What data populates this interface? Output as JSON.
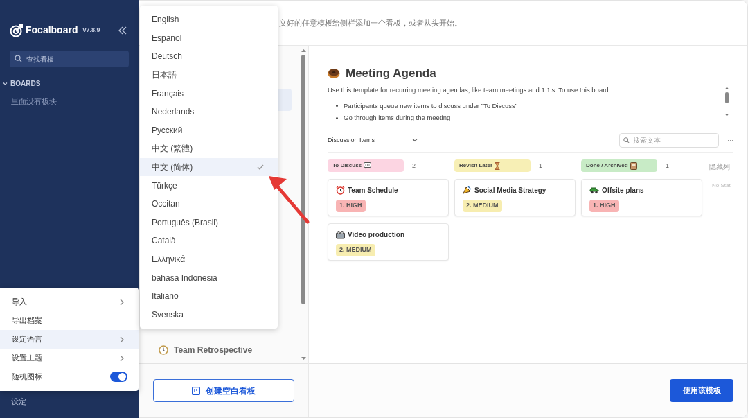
{
  "sidebar": {
    "logo": "Focalboard",
    "version": "v7.8.9",
    "search": {
      "placeholder": "查找看板"
    },
    "section": "BOARDS",
    "empty_text": "里面没有板块",
    "settings": "设定"
  },
  "settings_menu": [
    {
      "label": "导入",
      "kind": "submenu",
      "selected": false
    },
    {
      "label": "导出档案",
      "kind": "action",
      "selected": false
    },
    {
      "label": "设定语言",
      "kind": "submenu",
      "selected": true
    },
    {
      "label": "设置主题",
      "kind": "submenu",
      "selected": false
    },
    {
      "label": "随机图标",
      "kind": "toggle",
      "selected": false,
      "on": true
    }
  ],
  "language_menu": [
    {
      "label": "English",
      "selected": false
    },
    {
      "label": "Español",
      "selected": false
    },
    {
      "label": "Deutsch",
      "selected": false
    },
    {
      "label": "日本語",
      "selected": false
    },
    {
      "label": "Français",
      "selected": false
    },
    {
      "label": "Nederlands",
      "selected": false
    },
    {
      "label": "Русский",
      "selected": false
    },
    {
      "label": "中文 (繁體)",
      "selected": false
    },
    {
      "label": "中文 (简体)",
      "selected": true
    },
    {
      "label": "Türkçe",
      "selected": false
    },
    {
      "label": "Occitan",
      "selected": false
    },
    {
      "label": "Português (Brasil)",
      "selected": false
    },
    {
      "label": "Català",
      "selected": false
    },
    {
      "label": "Ελληνικά",
      "selected": false
    },
    {
      "label": "bahasa Indonesia",
      "selected": false
    },
    {
      "label": "Italiano",
      "selected": false
    },
    {
      "label": "Svenska",
      "selected": false
    }
  ],
  "dialog": {
    "intro": "义好的任意模板给侧栏添加一个看板，或者从头开始。",
    "templates": [
      {
        "label": "Team Retrospective"
      }
    ],
    "create_empty_button": "创建空白看板",
    "preview": {
      "title": "Meeting Agenda",
      "description": "Use this template for recurring meeting agendas, like team meetings and 1:1's. To use this board:",
      "bullets": [
        "Participants queue new items to discuss under \"To Discuss\"",
        "Go through items during the meeting"
      ],
      "view": "Discussion Items",
      "search": {
        "placeholder": "搜索文本"
      },
      "more": "···",
      "columns": [
        {
          "label": "To Discuss",
          "count": "2",
          "color": "#fcd5e2",
          "cards": [
            {
              "title": "Team Schedule",
              "priority": "1. HIGH",
              "color": "#f8b4b4"
            },
            {
              "title": "Video production",
              "priority": "2. MEDIUM",
              "color": "#f7edb0"
            }
          ]
        },
        {
          "label": "Revisit Later",
          "count": "1",
          "color": "#f7efb5",
          "cards": [
            {
              "title": "Social Media Strategy",
              "priority": "2. MEDIUM",
              "color": "#f7edb0"
            }
          ]
        },
        {
          "label": "Done / Archived",
          "count": "1",
          "color": "#c8ebc6",
          "cards": [
            {
              "title": "Offsite plans",
              "priority": "1. HIGH",
              "color": "#f8b4b4"
            }
          ]
        }
      ],
      "hidden_columns": "隐藏列",
      "hidden_column_item": "No Stat"
    },
    "use_button": "使用该模板"
  }
}
